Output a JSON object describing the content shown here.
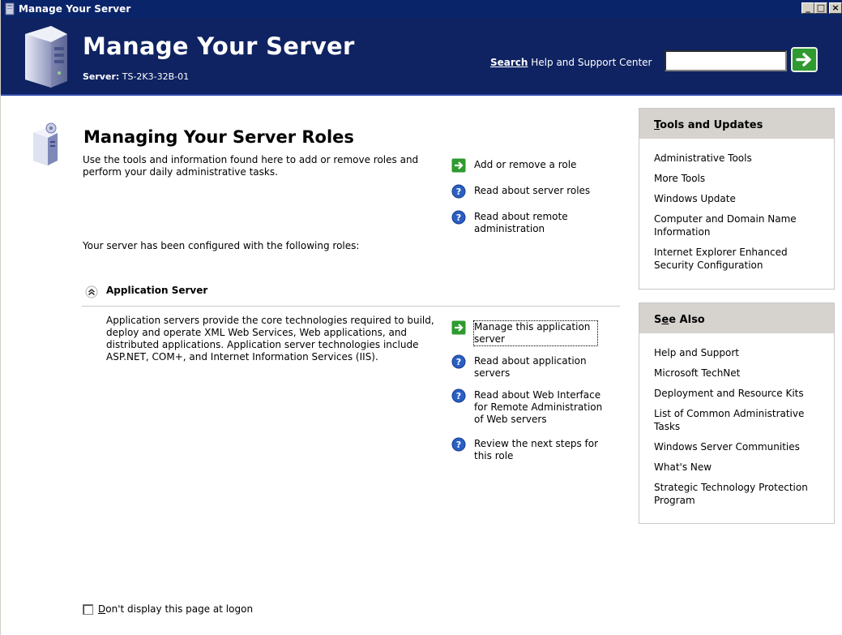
{
  "titlebar": {
    "title": "Manage Your Server",
    "icon": "server-icon",
    "controls": [
      "minimize",
      "maximize",
      "close"
    ]
  },
  "banner": {
    "heading": "Manage Your Server",
    "server_label": "Server:",
    "server_name": "TS-2K3-32B-01",
    "search_label_bold": "Search",
    "search_label_rest": " Help and Support Center",
    "search_value": "",
    "go_icon": "arrow-right-icon"
  },
  "roles": {
    "title": "Managing Your Server Roles",
    "description": "Use the tools and information found here to add or remove roles and perform your daily administrative tasks.",
    "tasks": [
      {
        "icon": "arrow-right-icon",
        "label": "Add or remove a role"
      },
      {
        "icon": "help-icon",
        "label": "Read about server roles"
      },
      {
        "icon": "help-icon",
        "label": "Read about remote administration"
      }
    ],
    "configured_text": "Your server has been configured with the following roles:"
  },
  "application_server": {
    "title": "Application Server",
    "toggle_icon": "collapse-up-icon",
    "description": "Application servers provide the core technologies required to build, deploy and operate XML Web Services, Web applications, and distributed applications. Application server technologies include ASP.NET, COM+, and Internet Information Services (IIS).",
    "tasks": [
      {
        "icon": "arrow-right-icon",
        "label": "Manage this application server"
      },
      {
        "icon": "help-icon",
        "label": "Read about application servers"
      },
      {
        "icon": "help-icon",
        "label": "Read about Web Interface for Remote Administration of Web servers"
      },
      {
        "icon": "help-icon",
        "label": "Review the next steps for this role"
      }
    ]
  },
  "tools_panel": {
    "title_first": "T",
    "title_rest": "ools and Updates",
    "items": [
      "Administrative Tools",
      "More Tools",
      "Windows Update",
      "Computer and Domain Name Information",
      "Internet Explorer Enhanced Security Configuration"
    ]
  },
  "see_also_panel": {
    "title_a": "S",
    "title_u": "e",
    "title_b": "e Also",
    "items": [
      "Help and Support",
      "Microsoft TechNet",
      "Deployment and Resource Kits",
      "List of Common Administrative Tasks",
      "Windows Server Communities",
      "What's New",
      "Strategic Technology Protection Program"
    ]
  },
  "footer": {
    "checkbox_checked": false,
    "checkbox_label_first": "D",
    "checkbox_label_rest": "on't display this page at logon"
  },
  "colors": {
    "titlebar": "#0a246a",
    "banner": "#0f2362",
    "panel_header": "#d6d3ce",
    "go_green": "#2f9a2f"
  }
}
